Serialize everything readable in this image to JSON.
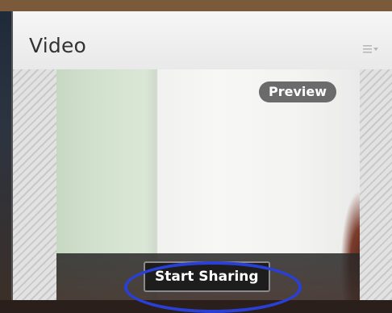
{
  "pod": {
    "title": "Video",
    "menu_icon": "list-menu-icon"
  },
  "video": {
    "preview_label": "Preview",
    "start_sharing_label": "Start Sharing"
  },
  "colors": {
    "highlight_ring": "#2a3fd6",
    "badge_bg": "#6b6b6b",
    "button_bg": "#1d1d1d"
  }
}
